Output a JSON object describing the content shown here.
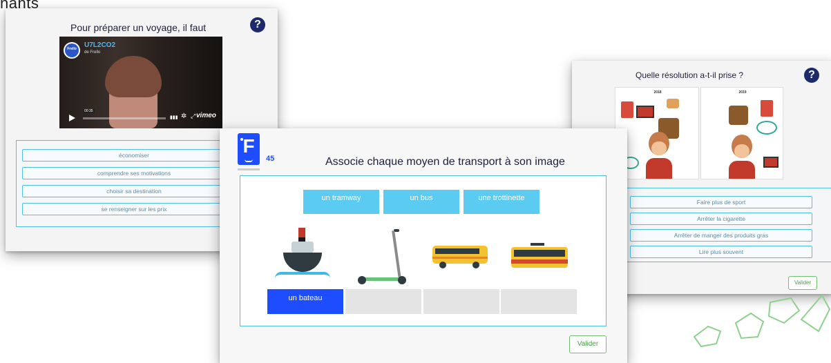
{
  "top_fragment": "nants",
  "card_left": {
    "title": "Pour préparer un voyage, il faut",
    "help": "?",
    "video": {
      "channel": "U7L2CO2",
      "byline": "de Frello",
      "logo_text": "Frello",
      "time": "00:35",
      "brand": "vimeo"
    },
    "choices": [
      "économiser",
      "comprendre ses motivations",
      "choisir sa destination",
      "se renseigner sur les prix"
    ]
  },
  "card_right": {
    "title": "Quelle résolution a-t-il prise ?",
    "help": "?",
    "year_left": "2018",
    "year_right": "2019",
    "choices": [
      "Faire plus de sport",
      "Arrêter la cigarette",
      "Arrêter de manger des produits gras",
      "Lire plus souvent"
    ],
    "validate": "Valider"
  },
  "card_center": {
    "logo_letter": "F",
    "number": "45",
    "title": "Associe chaque moyen de transport à son image",
    "words": [
      "un tramway",
      "un bus",
      "une trottinette"
    ],
    "placed": [
      "un bateau"
    ],
    "validate": "Valider"
  },
  "colors": {
    "accent": "#4cc1e6",
    "navy": "#1c2a6b",
    "tile": "#5ccbf1",
    "placed": "#1e4cff",
    "validate": "#4a9a4a"
  }
}
